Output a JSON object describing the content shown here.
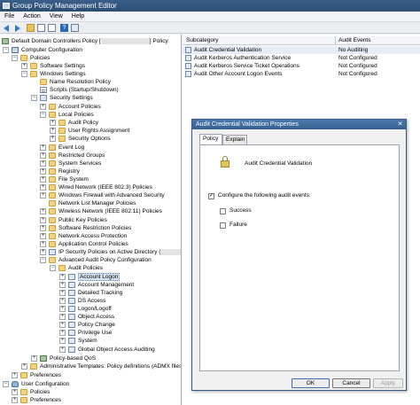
{
  "window": {
    "title": "Group Policy Management Editor"
  },
  "menu": {
    "file": "File",
    "action": "Action",
    "view": "View",
    "help": "Help"
  },
  "toolbar": {
    "help_glyph": "?"
  },
  "tree": {
    "root": {
      "prefix": "Default Domain Controllers Policy [",
      "suffix": "] Policy"
    },
    "computer_configuration": "Computer Configuration",
    "policies": "Policies",
    "software_settings": "Software Settings",
    "windows_settings": "Windows Settings",
    "name_resolution_policy": "Name Resolution Policy",
    "scripts": "Scripts (Startup/Shutdown)",
    "security_settings": "Security Settings",
    "account_policies": "Account Policies",
    "local_policies": "Local Policies",
    "audit_policy": "Audit Policy",
    "user_rights_assignment": "User Rights Assignment",
    "security_options": "Security Options",
    "event_log": "Event Log",
    "restricted_groups": "Restricted Groups",
    "system_services": "System Services",
    "registry": "Registry",
    "file_system": "File System",
    "wired_network": "Wired Network (IEEE 802.3) Policies",
    "windows_firewall": "Windows Firewall with Advanced Security",
    "network_list_manager": "Network List Manager Policies",
    "wireless_network": "Wireless Network (IEEE 802.11) Policies",
    "public_key_policies": "Public Key Policies",
    "software_restriction": "Software Restriction Policies",
    "network_access_protection": "Network Access Protection",
    "application_control": "Application Control Policies",
    "ip_security": "IP Security Policies on Active Directory (",
    "advanced_audit": "Advanced Audit Policy Configuration",
    "audit_policies": "Audit Policies",
    "account_logon": "Account Logon",
    "account_management": "Account Management",
    "detailed_tracking": "Detailed Tracking",
    "ds_access": "DS Access",
    "logon_logoff": "Logon/Logoff",
    "object_access": "Object Access",
    "policy_change": "Policy Change",
    "privilege_use": "Privilege Use",
    "system": "System",
    "global_object_access": "Global Object Access Auditing",
    "policy_based_qos": "Policy-based QoS",
    "admin_templates": "Administrative Templates: Policy definitions (ADMX files)",
    "preferences": "Preferences",
    "user_configuration": "User Configuration",
    "user_policies": "Policies",
    "user_preferences": "Preferences",
    "expand": "+",
    "collapse": "−"
  },
  "list": {
    "col_subcategory": "Subcategory",
    "col_audit_events": "Audit Events",
    "rows": [
      {
        "name": "Audit Credential Validation",
        "value": "No Auditing"
      },
      {
        "name": "Audit Kerberos Authentication Service",
        "value": "Not Configured"
      },
      {
        "name": "Audit Kerberos Service Ticket Operations",
        "value": "Not Configured"
      },
      {
        "name": "Audit Other Account Logon Events",
        "value": "Not Configured"
      }
    ]
  },
  "dialog": {
    "title": "Audit Credential Validation Properties",
    "close_glyph": "✕",
    "tab_policy": "Policy",
    "tab_explain": "Explain",
    "policy_name": "Audit Credential Validation",
    "configure_label": "Configure the following audit events:",
    "configure_checked": true,
    "check_glyph": "✓",
    "success_label": "Success",
    "failure_label": "Failure",
    "ok": "OK",
    "cancel": "Cancel",
    "apply": "Apply"
  }
}
